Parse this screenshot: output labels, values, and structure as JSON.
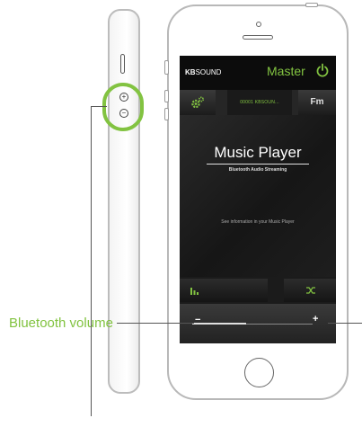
{
  "phone_app": {
    "brand_bold": "KB",
    "brand_rest": "SOUND",
    "master_label": "Master",
    "device_name": "00001 KBSOUN...",
    "fm_label": "Fm",
    "title": "Music Player",
    "subtitle": "Bluetooth Audio Streaming",
    "info": "See information in your Music Player",
    "volume_minus": "−",
    "volume_plus": "+",
    "volume_level": 0.45
  },
  "callout": {
    "label": "Bluetooth volume"
  },
  "colors": {
    "accent": "#82c341",
    "screen_bg": "#161616"
  },
  "icons": [
    "power-icon",
    "gear-icon",
    "equalizer-icon",
    "shuffle-icon",
    "volume-up-icon",
    "volume-down-icon"
  ]
}
